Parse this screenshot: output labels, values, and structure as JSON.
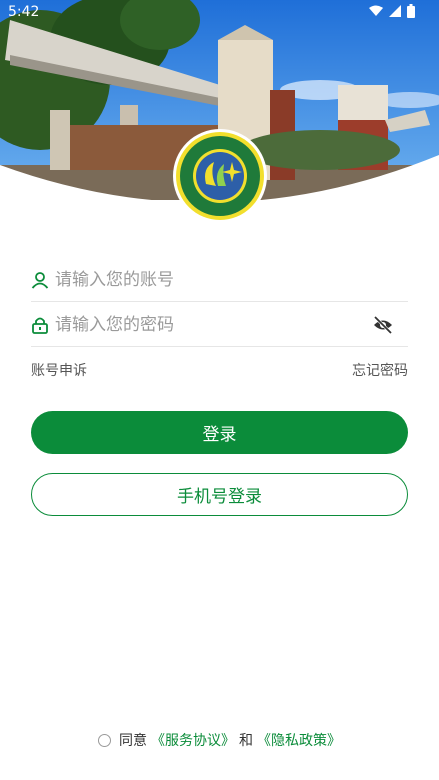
{
  "status": {
    "time": "5:42"
  },
  "form": {
    "account_placeholder": "请输入您的账号",
    "password_placeholder": "请输入您的密码"
  },
  "links": {
    "appeal": "账号申诉",
    "forgot": "忘记密码"
  },
  "buttons": {
    "login": "登录",
    "phone_login": "手机号登录"
  },
  "agreement": {
    "prefix": "同意",
    "service": "《服务协议》",
    "and": "和",
    "privacy": "《隐私政策》"
  },
  "colors": {
    "accent": "#0b8c3a"
  },
  "icons": {
    "account": "user-icon",
    "password": "lock-icon",
    "visibility": "eye-off-icon"
  }
}
